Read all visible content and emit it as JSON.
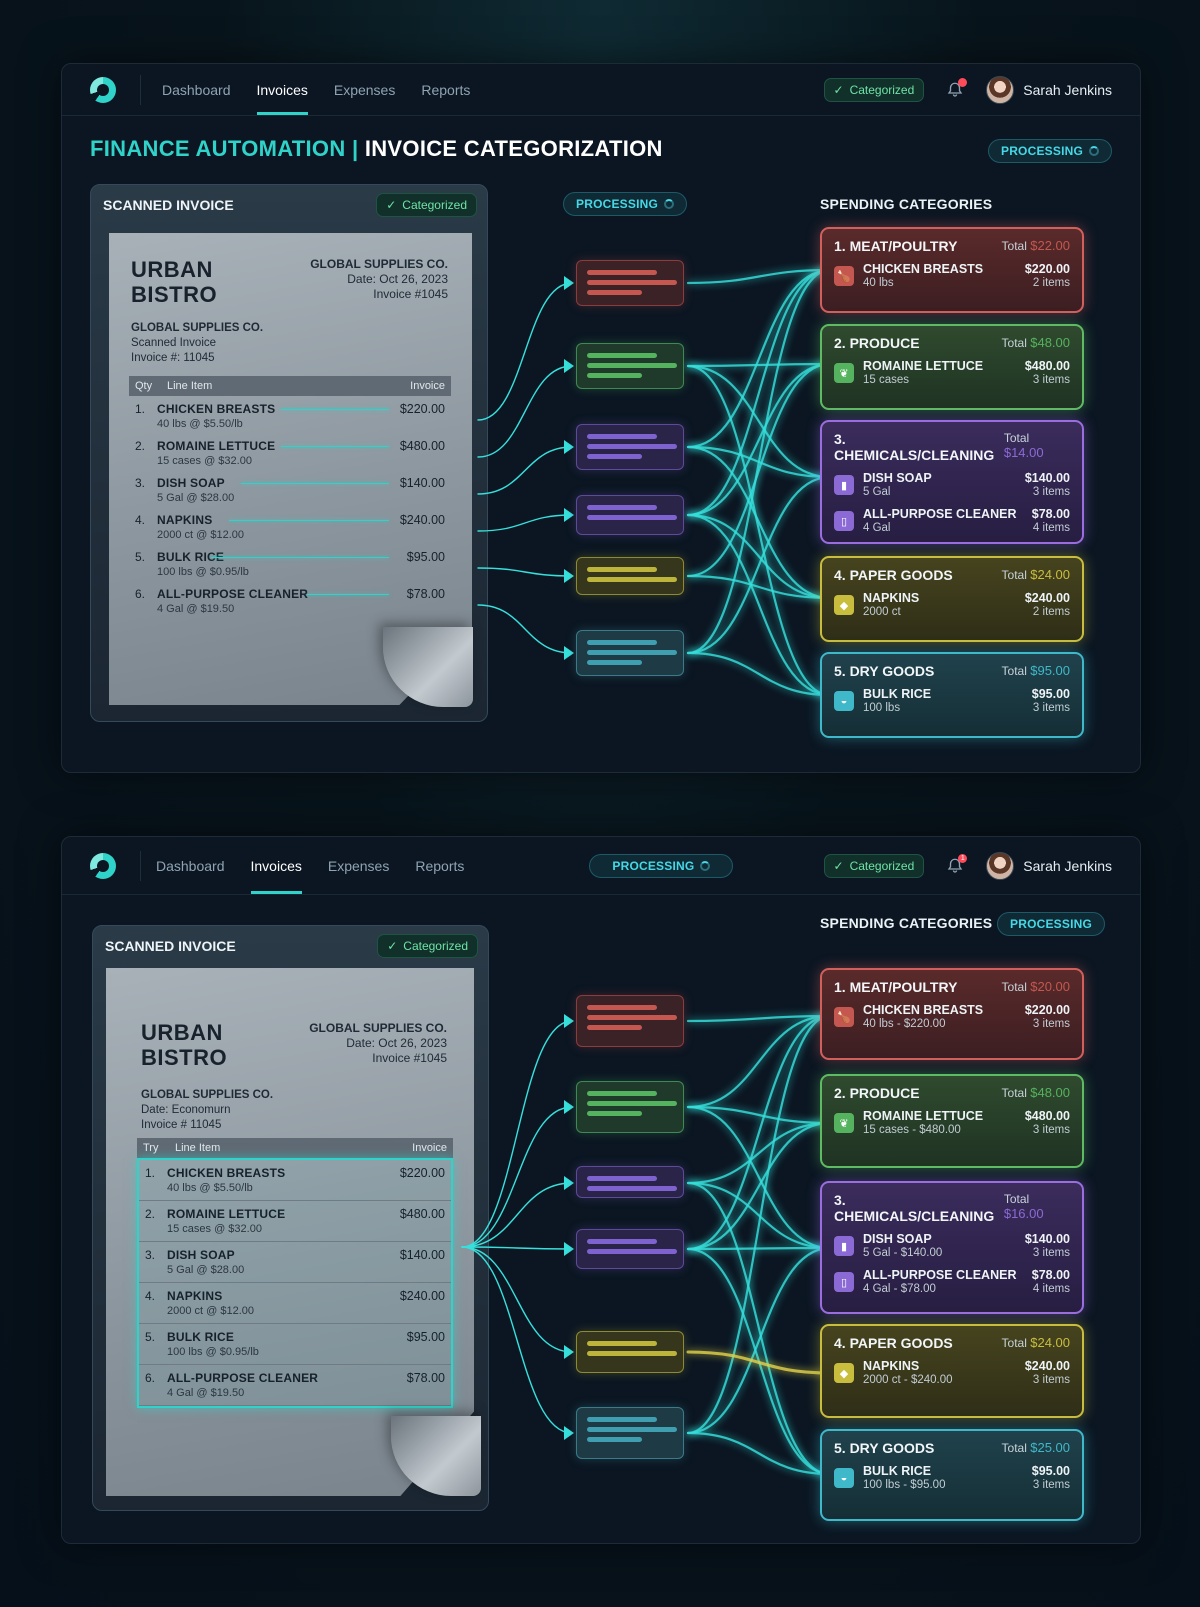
{
  "colors": {
    "accent": "#2fd3c9",
    "red": "#d1605d",
    "green": "#5fbb63",
    "purple": "#9a6de0",
    "yellow": "#c9bd3e",
    "teal": "#3fb8c9"
  },
  "nav": {
    "items": [
      "Dashboard",
      "Invoices",
      "Expenses",
      "Reports"
    ],
    "active": "Invoices",
    "status": "Categorized",
    "user": "Sarah Jenkins",
    "notifications": "1"
  },
  "page": {
    "title_accent": "FINANCE AUTOMATION |",
    "title_main": "INVOICE CATEGORIZATION",
    "status": "PROCESSING"
  },
  "scan": {
    "heading": "SCANNED INVOICE",
    "badge": "Categorized"
  },
  "processing_label": "PROCESSING",
  "categories_heading": "SPENDING CATEGORIES",
  "invoice1": {
    "business": [
      "URBAN",
      "BISTRO"
    ],
    "vendor": "GLOBAL SUPPLIES CO.",
    "date": "Date: Oct 26, 2023",
    "number": "Invoice #1045",
    "meta": [
      "GLOBAL SUPPLIES CO.",
      "Scanned Invoice",
      "Invoice #: 11045"
    ],
    "headers": [
      "Qty",
      "Line Item",
      "Invoice"
    ],
    "rows": [
      {
        "n": "1.",
        "name": "CHICKEN BREASTS",
        "detail": "40 lbs @ $5.50/lb",
        "amount": "$220.00"
      },
      {
        "n": "2.",
        "name": "ROMAINE LETTUCE",
        "detail": "15 cases @ $32.00",
        "amount": "$480.00"
      },
      {
        "n": "3.",
        "name": "DISH SOAP",
        "detail": "5 Gal @ $28.00",
        "amount": "$140.00"
      },
      {
        "n": "4.",
        "name": "NAPKINS",
        "detail": "2000 ct @ $12.00",
        "amount": "$240.00"
      },
      {
        "n": "5.",
        "name": "BULK RICE",
        "detail": "100 lbs @ $0.95/lb",
        "amount": "$95.00"
      },
      {
        "n": "6.",
        "name": "ALL-PURPOSE CLEANER",
        "detail": "4 Gal @ $19.50",
        "amount": "$78.00"
      }
    ]
  },
  "invoice2": {
    "business": [
      "URBAN",
      "BISTRO"
    ],
    "vendor": "GLOBAL SUPPLIES CO.",
    "date": "Date: Oct 26, 2023",
    "number": "Invoice #1045",
    "meta": [
      "GLOBAL SUPPLIES CO.",
      "Date: Economurn",
      "Invoice # 11045"
    ],
    "headers": [
      "Try",
      "Line Item",
      "Invoice"
    ],
    "rows": [
      {
        "n": "1.",
        "name": "CHICKEN BREASTS",
        "detail": "40 lbs @ $5.50/lb",
        "amount": "$220.00"
      },
      {
        "n": "2.",
        "name": "ROMAINE LETTUCE",
        "detail": "15 cases @ $32.00",
        "amount": "$480.00"
      },
      {
        "n": "3.",
        "name": "DISH SOAP",
        "detail": "5 Gal @ $28.00",
        "amount": "$140.00"
      },
      {
        "n": "4.",
        "name": "NAPKINS",
        "detail": "2000 ct @ $12.00",
        "amount": "$240.00"
      },
      {
        "n": "5.",
        "name": "BULK RICE",
        "detail": "100 lbs @ $0.95/lb",
        "amount": "$95.00"
      },
      {
        "n": "6.",
        "name": "ALL-PURPOSE CLEANER",
        "detail": "4 Gal @ $19.50",
        "amount": "$78.00"
      }
    ]
  },
  "cats1": [
    {
      "title": "1. MEAT/POULTRY",
      "total": "$22.00",
      "tone": "red",
      "items": [
        {
          "icon": "drumstick-icon",
          "name": "CHICKEN BREASTS",
          "detail": "40 lbs",
          "price": "$220.00",
          "count": "2 items"
        }
      ]
    },
    {
      "title": "2. PRODUCE",
      "total": "$48.00",
      "tone": "green",
      "items": [
        {
          "icon": "leaf-icon",
          "name": "ROMAINE LETTUCE",
          "detail": "15 cases",
          "price": "$480.00",
          "count": "3 items"
        }
      ]
    },
    {
      "title": "3. CHEMICALS/CLEANING",
      "total": "$14.00",
      "tone": "purple",
      "items": [
        {
          "icon": "soap-bottle-icon",
          "name": "DISH SOAP",
          "detail": "5 Gal",
          "price": "$140.00",
          "count": "3 items"
        },
        {
          "icon": "spray-bottle-icon",
          "name": "ALL-PURPOSE CLEANER",
          "detail": "4 Gal",
          "price": "$78.00",
          "count": "4 items"
        }
      ]
    },
    {
      "title": "4. PAPER GOODS",
      "total": "$24.00",
      "tone": "yellow",
      "items": [
        {
          "icon": "napkin-icon",
          "name": "NAPKINS",
          "detail": "2000 ct",
          "price": "$240.00",
          "count": "2 items"
        }
      ]
    },
    {
      "title": "5. DRY GOODS",
      "total": "$95.00",
      "tone": "teal",
      "items": [
        {
          "icon": "rice-bowl-icon",
          "name": "BULK RICE",
          "detail": "100 lbs",
          "price": "$95.00",
          "count": "3 items"
        }
      ]
    }
  ],
  "cats2": [
    {
      "title": "1. MEAT/POULTRY",
      "total": "$20.00",
      "tone": "red",
      "items": [
        {
          "icon": "drumstick-icon",
          "name": "CHICKEN BREASTS",
          "detail": "40 lbs - $220.00",
          "price": "$220.00",
          "count": "3 items"
        }
      ]
    },
    {
      "title": "2. PRODUCE",
      "total": "$48.00",
      "tone": "green",
      "items": [
        {
          "icon": "leaf-icon",
          "name": "ROMAINE LETTUCE",
          "detail": "15 cases - $480.00",
          "price": "$480.00",
          "count": "3 items"
        }
      ]
    },
    {
      "title": "3. CHEMICALS/CLEANING",
      "total": "$16.00",
      "tone": "purple",
      "items": [
        {
          "icon": "soap-bottle-icon",
          "name": "DISH SOAP",
          "detail": "5 Gal - $140.00",
          "price": "$140.00",
          "count": "3 items"
        },
        {
          "icon": "spray-bottle-icon",
          "name": "ALL-PURPOSE CLEANER",
          "detail": "4 Gal - $78.00",
          "price": "$78.00",
          "count": "4 items"
        }
      ]
    },
    {
      "title": "4. PAPER GOODS",
      "total": "$24.00",
      "tone": "yellow",
      "items": [
        {
          "icon": "napkin-icon",
          "name": "NAPKINS",
          "detail": "2000 ct - $240.00",
          "price": "$240.00",
          "count": "3 items"
        }
      ]
    },
    {
      "title": "5. DRY GOODS",
      "total": "$25.00",
      "tone": "teal",
      "items": [
        {
          "icon": "rice-bowl-icon",
          "name": "BULK RICE",
          "detail": "100 lbs - $95.00",
          "price": "$95.00",
          "count": "3 items"
        }
      ]
    }
  ],
  "total_label": "Total"
}
